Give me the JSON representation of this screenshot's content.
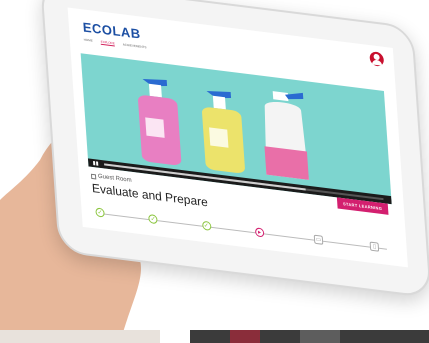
{
  "app": {
    "logo": "ECOLAB",
    "nav": [
      "Home",
      "Explore",
      "Achievements"
    ],
    "active_nav_index": 1
  },
  "lesson": {
    "category": "Guest Room",
    "title": "Evaluate and Prepare",
    "cta": "START LEARNING"
  },
  "video": {
    "progress": 0.72,
    "products": [
      "pink spray bottle",
      "yellow spray bottle",
      "white pump sprayer"
    ]
  },
  "steps": [
    {
      "state": "done",
      "icon": "check-icon"
    },
    {
      "state": "done",
      "icon": "check-icon"
    },
    {
      "state": "done",
      "icon": "check-icon"
    },
    {
      "state": "current",
      "icon": "play-icon"
    },
    {
      "state": "todo",
      "icon": "lesson-icon"
    },
    {
      "state": "todo",
      "icon": "lesson-icon"
    }
  ],
  "colors": {
    "brand_blue": "#1c4fa3",
    "accent_pink": "#d31f6f",
    "video_bg": "#7dd5cf",
    "avatar_red": "#c8102e",
    "done_green": "#8cc63f"
  }
}
